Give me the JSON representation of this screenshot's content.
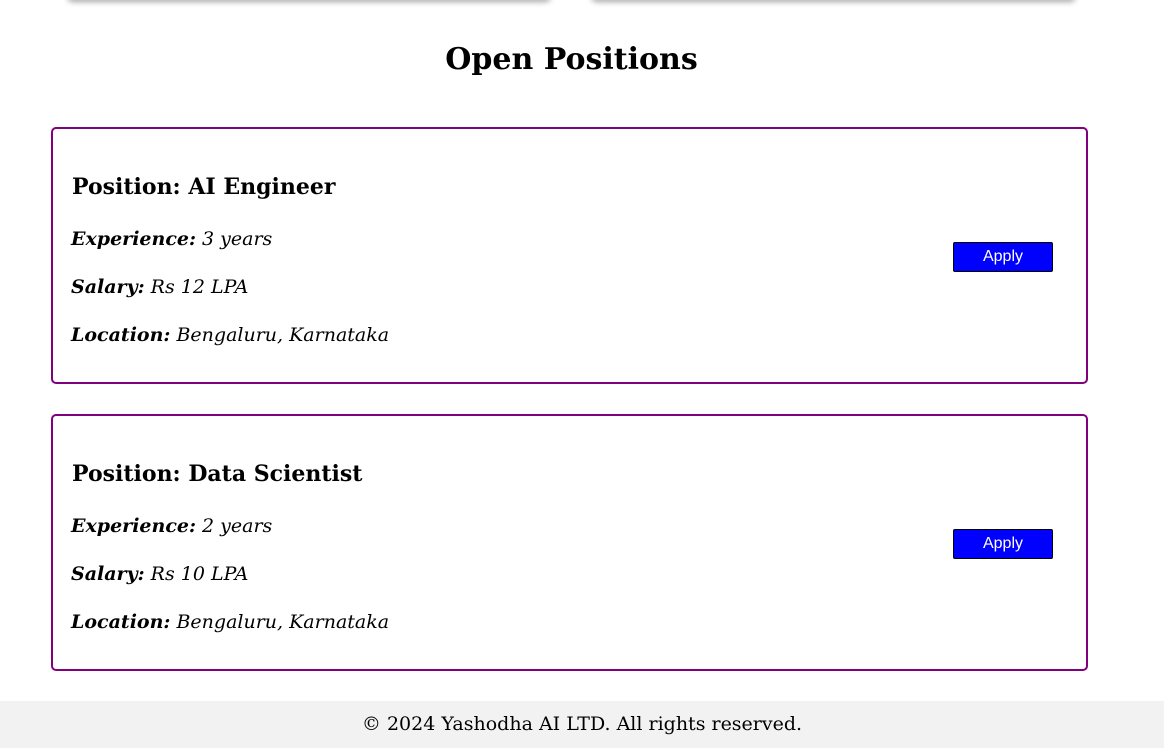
{
  "section": {
    "title": "Open Positions"
  },
  "jobs": [
    {
      "title": "Position: AI Engineer",
      "experience_label": "Experience:",
      "experience_value": "3 years",
      "salary_label": "Salary:",
      "salary_value": "Rs 12 LPA",
      "location_label": "Location:",
      "location_value": "Bengaluru, Karnataka",
      "apply_label": "Apply"
    },
    {
      "title": "Position: Data Scientist",
      "experience_label": "Experience:",
      "experience_value": "2 years",
      "salary_label": "Salary:",
      "salary_value": "Rs 10 LPA",
      "location_label": "Location:",
      "location_value": "Bengaluru, Karnataka",
      "apply_label": "Apply"
    }
  ],
  "footer": {
    "copyright": "© 2024 Yashodha AI LTD. All rights reserved."
  },
  "colors": {
    "card_border": "#800080",
    "apply_button": "#0000ff",
    "footer_background": "#f2f2f2"
  }
}
